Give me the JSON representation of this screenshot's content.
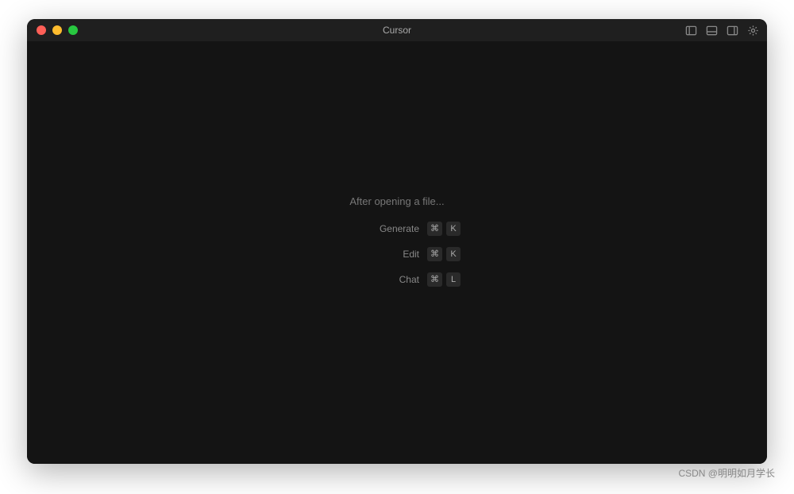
{
  "window": {
    "title": "Cursor"
  },
  "welcome": {
    "heading": "After opening a file...",
    "shortcuts": [
      {
        "label": "Generate",
        "mod": "⌘",
        "key": "K"
      },
      {
        "label": "Edit",
        "mod": "⌘",
        "key": "K"
      },
      {
        "label": "Chat",
        "mod": "⌘",
        "key": "L"
      }
    ]
  },
  "watermark": "CSDN @明明如月学长"
}
